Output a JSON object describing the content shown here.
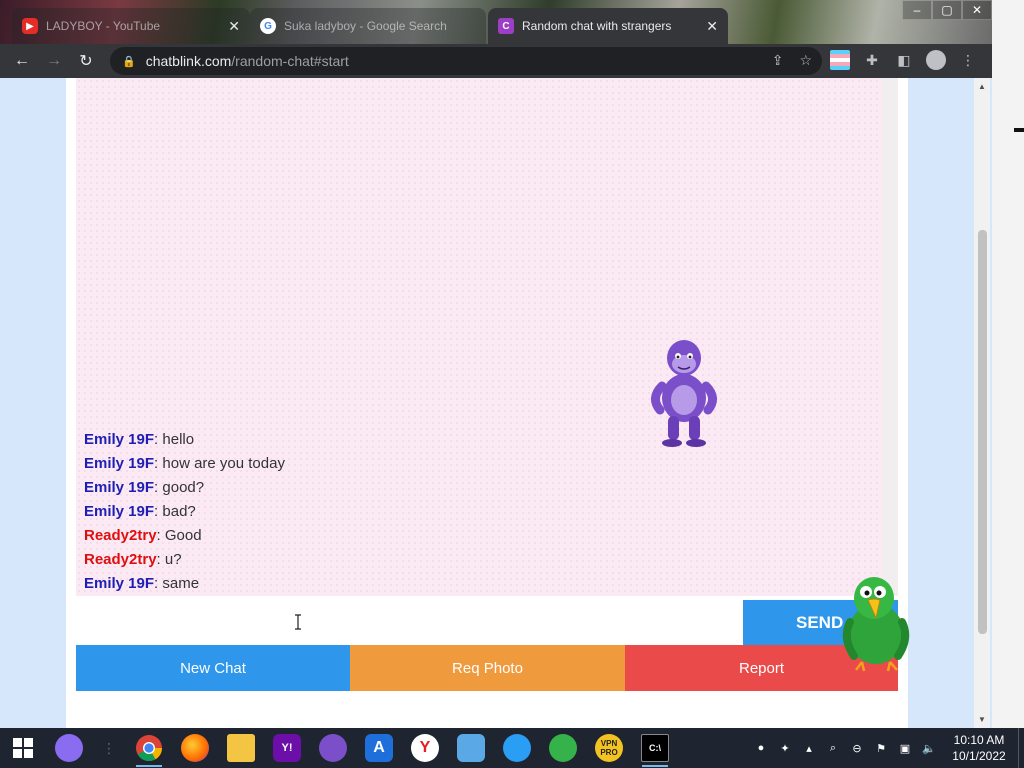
{
  "browser": {
    "tabs": [
      {
        "title": "LADYBOY - YouTube",
        "favicon": "youtube-icon",
        "active": false
      },
      {
        "title": "Suka ladyboy - Google Search",
        "favicon": "google-icon",
        "active": false
      },
      {
        "title": "Random chat with strangers",
        "favicon": "chatblink-icon",
        "active": true
      }
    ],
    "close_glyph": "✕",
    "url_host": "chatblink.com",
    "url_path": "/random-chat#start"
  },
  "chat": {
    "messages": [
      {
        "sender": "Emily 19F",
        "text": ": hello",
        "role": "stranger"
      },
      {
        "sender": "Emily 19F",
        "text": ": how are you today",
        "role": "stranger"
      },
      {
        "sender": "Emily 19F",
        "text": ": good?",
        "role": "stranger"
      },
      {
        "sender": "Emily 19F",
        "text": ": bad?",
        "role": "stranger"
      },
      {
        "sender": "Ready2try",
        "text": ": Good",
        "role": "me"
      },
      {
        "sender": "Ready2try",
        "text": ": u?",
        "role": "me"
      },
      {
        "sender": "Emily 19F",
        "text": ": same",
        "role": "stranger"
      }
    ],
    "input_value": "",
    "send_label": "SEND",
    "buttons": {
      "new_chat": "New Chat",
      "req_photo": "Req Photo",
      "report": "Report"
    },
    "colors": {
      "stranger": "#1f1fb5",
      "me": "#e00f0f",
      "send": "#2e96eb",
      "photo": "#f09a3e",
      "report": "#ea4a4a"
    }
  },
  "taskbar": {
    "time": "10:10 AM",
    "date": "10/1/2022",
    "vpn_label": "VPN PRO"
  }
}
